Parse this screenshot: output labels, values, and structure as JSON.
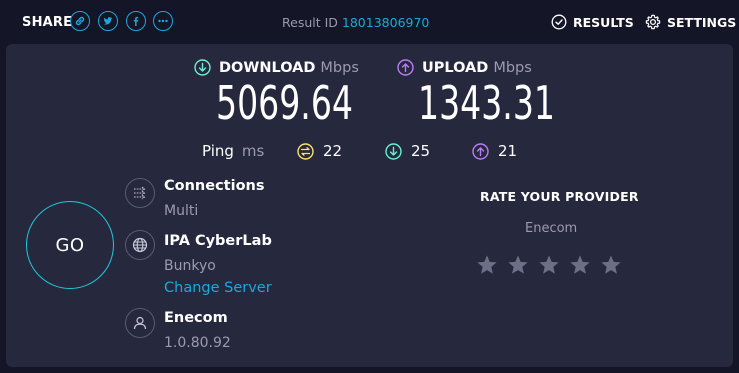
{
  "header": {
    "share_label": "SHARE",
    "share_icons": [
      "link-icon",
      "twitter-icon",
      "facebook-icon",
      "more-icon"
    ],
    "result_id_label": "Result ID",
    "result_id_value": "18013806970",
    "results_label": "RESULTS",
    "settings_label": "SETTINGS"
  },
  "download": {
    "label": "DOWNLOAD",
    "unit": "Mbps",
    "value": "5069.64",
    "color": "#6cf1d0"
  },
  "upload": {
    "label": "UPLOAD",
    "unit": "Mbps",
    "value": "1343.31",
    "color": "#b97ef5"
  },
  "ping": {
    "label": "Ping",
    "unit": "ms",
    "idle": "22",
    "download": "25",
    "upload": "21",
    "idle_color": "#fbe36a"
  },
  "go_label": "GO",
  "connections": {
    "title": "Connections",
    "value": "Multi"
  },
  "server": {
    "title": "IPA CyberLab",
    "location": "Bunkyo",
    "change_label": "Change Server"
  },
  "isp": {
    "title": "Enecom",
    "ip": "1.0.80.92"
  },
  "rate": {
    "title": "RATE YOUR PROVIDER",
    "provider": "Enecom",
    "stars": 5,
    "rating": 0
  },
  "colors": {
    "accent": "#1ca8dd",
    "background": "#141526",
    "panel": "#26283d",
    "muted": "#9a9bb0"
  }
}
